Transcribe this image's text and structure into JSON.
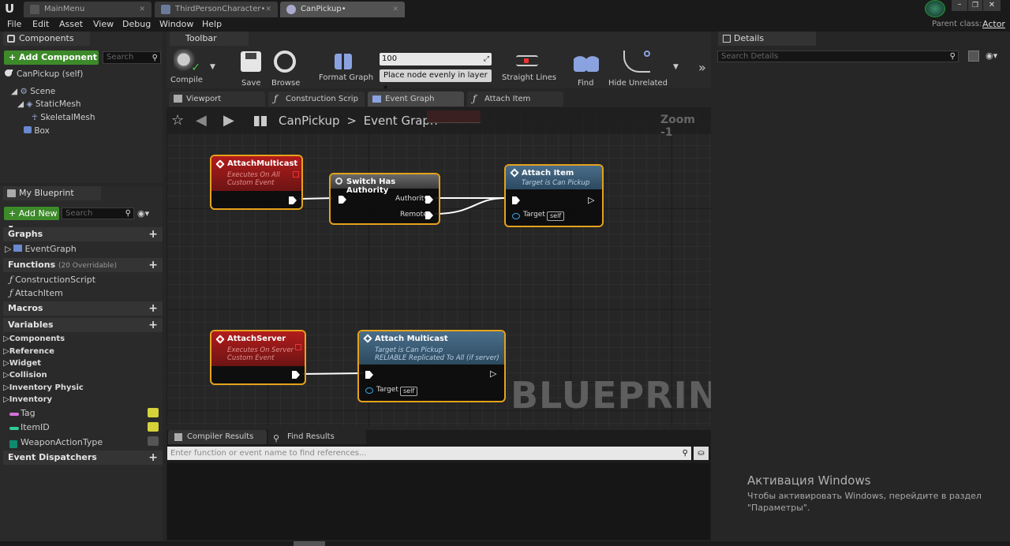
{
  "tabs": [
    {
      "label": "MainMenu"
    },
    {
      "label": "ThirdPersonCharacter•"
    },
    {
      "label": "CanPickup•"
    }
  ],
  "menu": [
    "File",
    "Edit",
    "Asset",
    "View",
    "Debug",
    "Window",
    "Help"
  ],
  "parent_class": {
    "label": "Parent class:",
    "value": "Actor"
  },
  "components": {
    "title": "Components",
    "add_button": "+ Add Component ▾",
    "search_placeholder": "Search",
    "self_item": "CanPickup (self)",
    "tree": [
      "Scene",
      "StaticMesh",
      "SkeletalMesh",
      "Box"
    ]
  },
  "my_blueprint": {
    "title": "My Blueprint",
    "add_button": "+ Add New ▾",
    "search_placeholder": "Search",
    "sections": {
      "graphs": "Graphs",
      "functions": "Functions",
      "functions_note": "(20 Overridable)",
      "macros": "Macros",
      "variables": "Variables",
      "dispatchers": "Event Dispatchers"
    },
    "graph_items": [
      "EventGraph"
    ],
    "function_items": [
      "ConstructionScript",
      "AttachItem"
    ],
    "variable_categories": [
      "Components",
      "Reference",
      "Widget",
      "Collision",
      "Inventory Physic",
      "Inventory"
    ],
    "variables": [
      {
        "name": "Tag",
        "color": "#d470d8"
      },
      {
        "name": "ItemID",
        "color": "#2ecd9c"
      },
      {
        "name": "WeaponActionType",
        "color": "#0f8a6f"
      }
    ]
  },
  "toolbar": {
    "title": "Toolbar",
    "buttons": [
      "Compile",
      "Save",
      "Browse",
      "Format Graph",
      "Straight Lines",
      "Find",
      "Hide Unrelated"
    ],
    "spacing_value": "100",
    "layout_select": "Place node evenly in layer ▾"
  },
  "graph_tabs": [
    "Viewport",
    "Construction Scrip",
    "Event Graph",
    "Attach Item"
  ],
  "breadcrumb": {
    "blueprint": "CanPickup",
    "separator": ">",
    "graph": "Event Graph"
  },
  "zoom": "Zoom -1",
  "watermark": "BLUEPRINT",
  "nodes": {
    "attach_multicast_event": {
      "title": "AttachMulticast",
      "sub1": "Executes On All",
      "sub2": "Custom Event"
    },
    "switch_has_authority": {
      "title": "Switch Has Authority",
      "pin1": "Authority",
      "pin2": "Remote"
    },
    "attach_item": {
      "title": "Attach Item",
      "sub1": "Target is Can Pickup",
      "pin": "Target",
      "self": "self"
    },
    "attach_server_event": {
      "title": "AttachServer",
      "sub1": "Executes On Server",
      "sub2": "Custom Event"
    },
    "attach_multicast_call": {
      "title": "Attach Multicast",
      "sub1": "Target is Can Pickup",
      "sub2": "RELIABLE Replicated To All (if server)",
      "pin": "Target",
      "self": "self"
    }
  },
  "bottom": {
    "tabs": [
      "Compiler Results",
      "Find Results"
    ],
    "find_placeholder": "Enter function or event name to find references..."
  },
  "details": {
    "title": "Details",
    "search_placeholder": "Search Details"
  },
  "windows_activation": {
    "title": "Активация Windows",
    "line1": "Чтобы активировать Windows, перейдите в раздел",
    "line2": "\"Параметры\"."
  }
}
